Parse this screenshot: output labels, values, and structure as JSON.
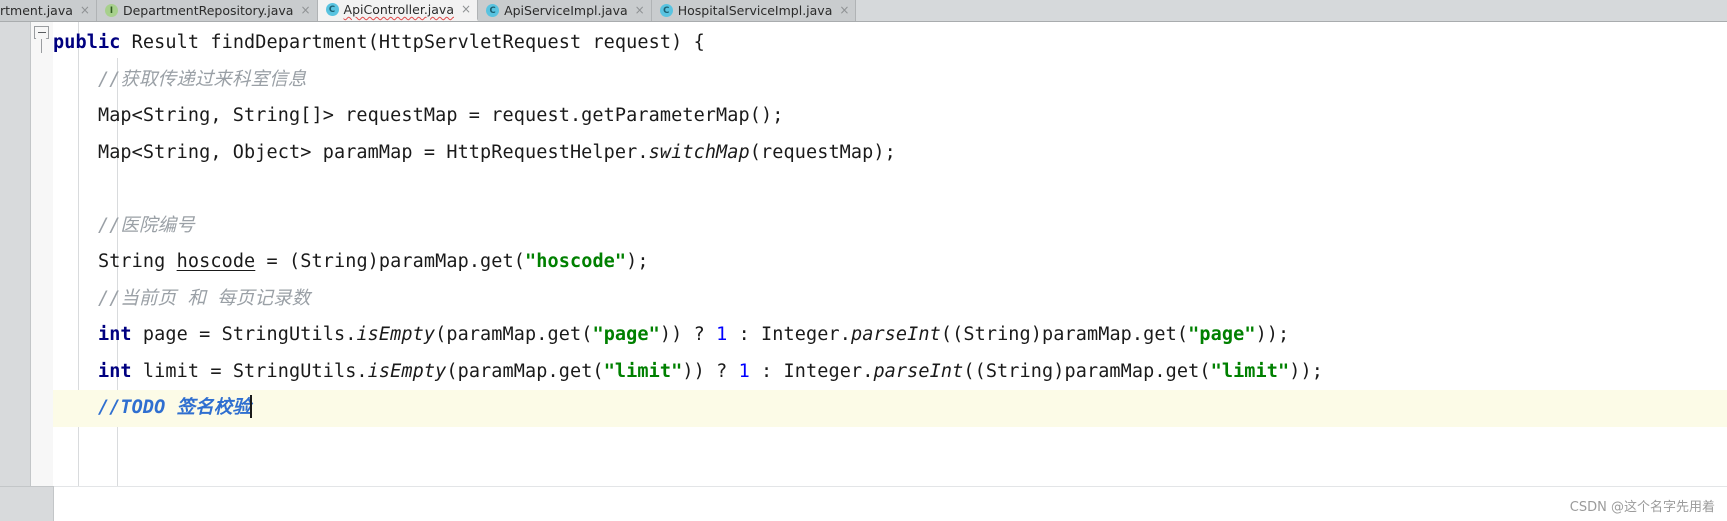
{
  "window": {
    "application": "IntelliJ IDEA Java Editor"
  },
  "tabbar": {
    "tabs": [
      {
        "label": "rtment.java",
        "icon": "class-icon",
        "icon_letter": "C",
        "icon_kind": "c",
        "active": false,
        "clipped": true,
        "has_error": false,
        "close_label": "×"
      },
      {
        "label": "DepartmentRepository.java",
        "icon": "interface-icon",
        "icon_letter": "I",
        "icon_kind": "i",
        "active": false,
        "clipped": false,
        "has_error": false,
        "close_label": "×"
      },
      {
        "label": "ApiController.java",
        "icon": "class-icon",
        "icon_letter": "C",
        "icon_kind": "c",
        "active": true,
        "clipped": false,
        "has_error": true,
        "close_label": "×"
      },
      {
        "label": "ApiServiceImpl.java",
        "icon": "class-icon",
        "icon_letter": "C",
        "icon_kind": "c",
        "active": false,
        "clipped": false,
        "has_error": false,
        "close_label": "×"
      },
      {
        "label": "HospitalServiceImpl.java",
        "icon": "class-icon",
        "icon_letter": "C",
        "icon_kind": "c",
        "active": false,
        "clipped": false,
        "has_error": false,
        "close_label": "×"
      }
    ]
  },
  "editor": {
    "fold_marker": "collapse-fold-icon",
    "code_lines": [
      {
        "id": "line-method-signature",
        "indent": 0,
        "caret_line": false,
        "tokens": [
          {
            "t": "public",
            "c": "kw"
          },
          {
            "t": " Result findDepartment",
            "c": "plain"
          },
          {
            "t": "(HttpServletRequest request) {",
            "c": "plain"
          }
        ]
      },
      {
        "id": "line-comment-params",
        "indent": 1,
        "caret_line": false,
        "tokens": [
          {
            "t": "//获取传递过来科室信息",
            "c": "cmt"
          }
        ]
      },
      {
        "id": "line-request-map",
        "indent": 1,
        "caret_line": false,
        "tokens": [
          {
            "t": "Map<String, String[]> requestMap = request.getParameterMap();",
            "c": "plain"
          }
        ]
      },
      {
        "id": "line-param-map",
        "indent": 1,
        "caret_line": false,
        "tokens": [
          {
            "t": "Map<String, Object> paramMap = HttpRequestHelper.",
            "c": "plain"
          },
          {
            "t": "switchMap",
            "c": "stat"
          },
          {
            "t": "(requestMap);",
            "c": "plain"
          }
        ]
      },
      {
        "id": "line-blank-1",
        "indent": 1,
        "caret_line": false,
        "tokens": []
      },
      {
        "id": "line-comment-hospital-code",
        "indent": 1,
        "caret_line": false,
        "tokens": [
          {
            "t": "//医院编号",
            "c": "cmt"
          }
        ]
      },
      {
        "id": "line-hoscode",
        "indent": 1,
        "caret_line": false,
        "tokens": [
          {
            "t": "String ",
            "c": "plain"
          },
          {
            "t": "hoscode",
            "c": "fld"
          },
          {
            "t": " = (String)paramMap.get(",
            "c": "plain"
          },
          {
            "t": "\"hoscode\"",
            "c": "str"
          },
          {
            "t": ");",
            "c": "plain"
          }
        ]
      },
      {
        "id": "line-comment-page",
        "indent": 1,
        "caret_line": false,
        "tokens": [
          {
            "t": "//当前页 和 每页记录数",
            "c": "cmt"
          }
        ]
      },
      {
        "id": "line-page",
        "indent": 1,
        "caret_line": false,
        "tokens": [
          {
            "t": "int",
            "c": "kw"
          },
          {
            "t": " page = StringUtils.",
            "c": "plain"
          },
          {
            "t": "isEmpty",
            "c": "stat"
          },
          {
            "t": "(paramMap.get(",
            "c": "plain"
          },
          {
            "t": "\"page\"",
            "c": "str"
          },
          {
            "t": ")) ? ",
            "c": "plain"
          },
          {
            "t": "1",
            "c": "num"
          },
          {
            "t": " : Integer.",
            "c": "plain"
          },
          {
            "t": "parseInt",
            "c": "stat"
          },
          {
            "t": "((String)paramMap.get(",
            "c": "plain"
          },
          {
            "t": "\"page\"",
            "c": "str"
          },
          {
            "t": "));",
            "c": "plain"
          }
        ]
      },
      {
        "id": "line-limit",
        "indent": 1,
        "caret_line": false,
        "tokens": [
          {
            "t": "int",
            "c": "kw"
          },
          {
            "t": " limit = StringUtils.",
            "c": "plain"
          },
          {
            "t": "isEmpty",
            "c": "stat"
          },
          {
            "t": "(paramMap.get(",
            "c": "plain"
          },
          {
            "t": "\"limit\"",
            "c": "str"
          },
          {
            "t": ")) ? ",
            "c": "plain"
          },
          {
            "t": "1",
            "c": "num"
          },
          {
            "t": " : Integer.",
            "c": "plain"
          },
          {
            "t": "parseInt",
            "c": "stat"
          },
          {
            "t": "((String)paramMap.get(",
            "c": "plain"
          },
          {
            "t": "\"limit\"",
            "c": "str"
          },
          {
            "t": "));",
            "c": "plain"
          }
        ]
      },
      {
        "id": "line-todo",
        "indent": 1,
        "caret_line": true,
        "caret": true,
        "tokens": [
          {
            "t": "//TODO 签名校验",
            "c": "todo"
          }
        ]
      }
    ]
  },
  "watermark": {
    "text": "CSDN @这个名字先用着"
  },
  "colors": {
    "keyword": "#000080",
    "string": "#008000",
    "comment": "#9aa0a6",
    "number": "#0000ff",
    "todo": "#2f6fd0",
    "tab_active_bg": "#f2f2f2",
    "tab_inactive_bg": "#c9ccce",
    "gutter_bg": "#d8dadc",
    "caret_line_bg": "#fcfbe7"
  }
}
